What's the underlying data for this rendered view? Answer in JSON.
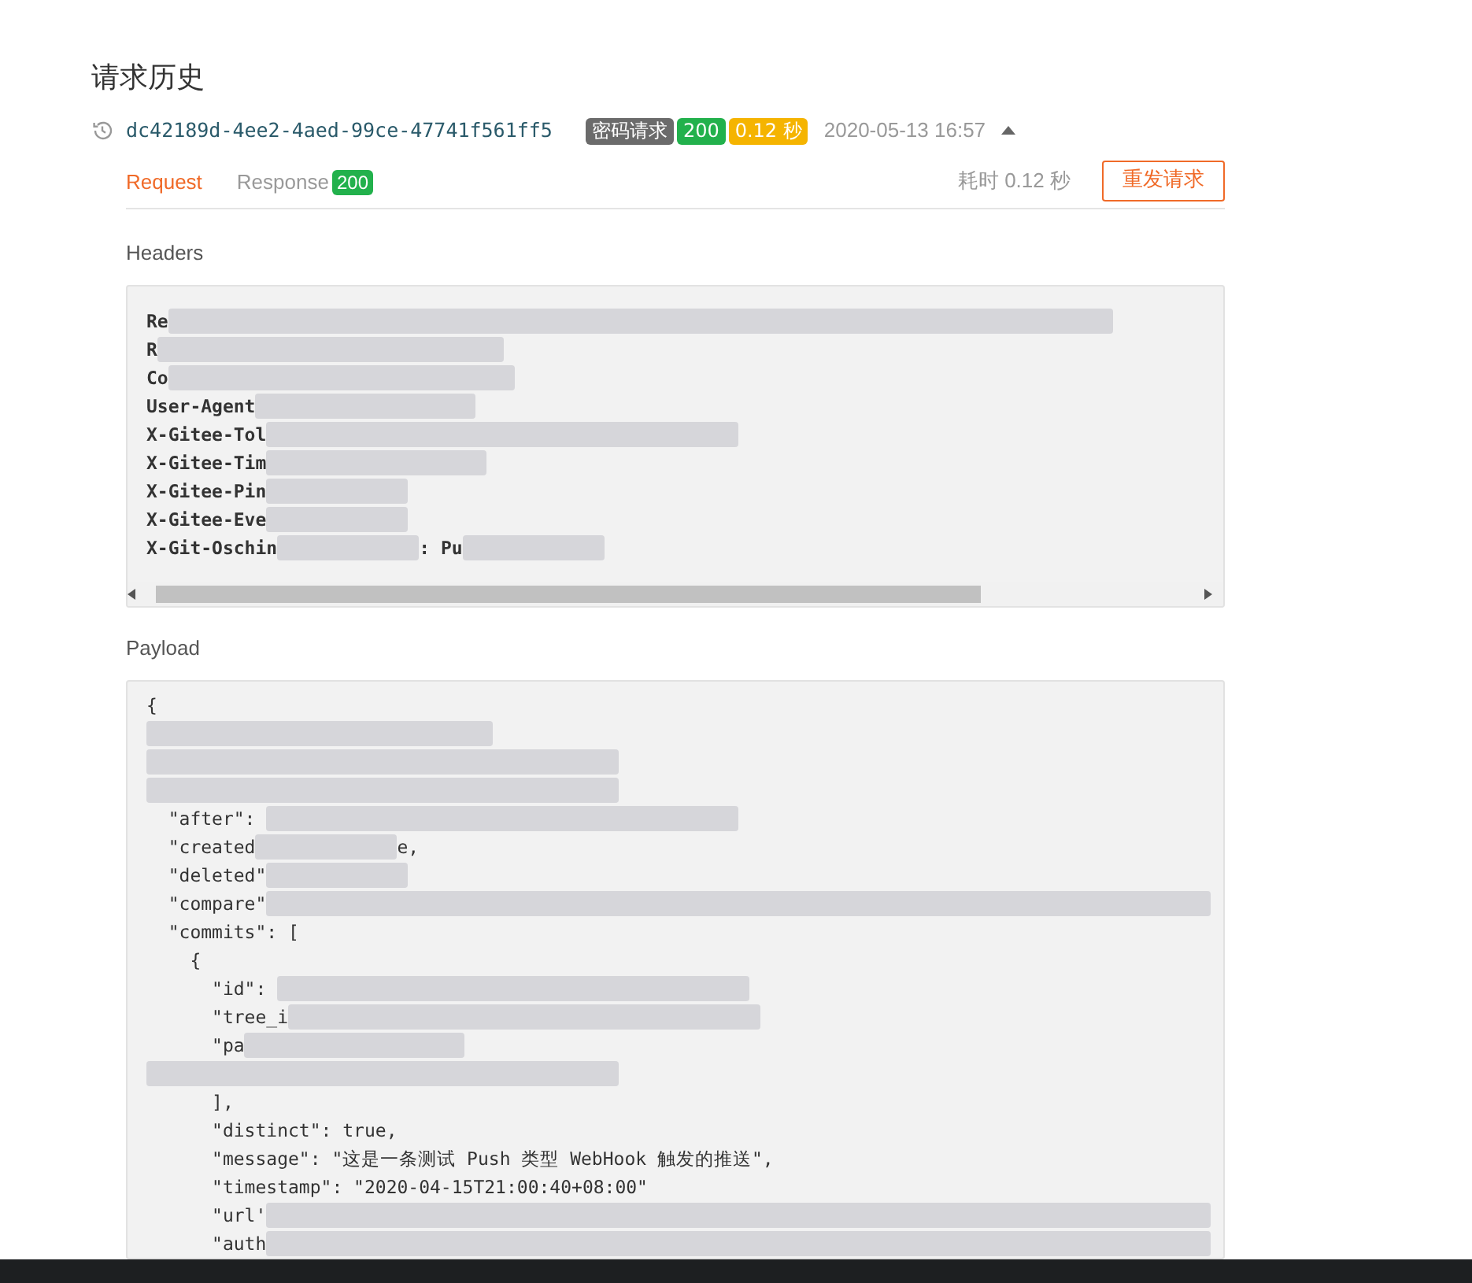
{
  "page_title": "请求历史",
  "request": {
    "id": "dc42189d-4ee2-4aed-99ce-47741f561ff5",
    "badges": [
      {
        "text": "密码请求",
        "color": "#6b6b6b"
      },
      {
        "text": "200",
        "color": "#22b14c"
      },
      {
        "text": "0.12 秒",
        "color": "#f5b400"
      }
    ],
    "time": "2020-05-13 16:57",
    "expanded": true
  },
  "tabs": [
    {
      "label": "Request",
      "selected": true
    },
    {
      "label": "Response",
      "badge": "200",
      "selected": false
    }
  ],
  "duration": "耗时 0.12 秒",
  "resend_button": "重发请求",
  "headers": {
    "label": "Headers",
    "lines": [
      [
        {
          "kind": "text",
          "text": "Re"
        },
        {
          "kind": "redacted"
        }
      ],
      [
        {
          "kind": "text",
          "text": "R"
        },
        {
          "kind": "redacted"
        }
      ],
      [
        {
          "kind": "text",
          "text": "Co"
        },
        {
          "kind": "redacted"
        }
      ],
      [
        {
          "kind": "text",
          "text": "User-Agent"
        },
        {
          "kind": "redacted"
        }
      ],
      [
        {
          "kind": "text",
          "text": "X-Gitee-Tol"
        },
        {
          "kind": "redacted"
        }
      ],
      [
        {
          "kind": "text",
          "text": "X-Gitee-Tim"
        },
        {
          "kind": "redacted"
        }
      ],
      [
        {
          "kind": "text",
          "text": "X-Gitee-Pin"
        },
        {
          "kind": "redacted"
        }
      ],
      [
        {
          "kind": "text",
          "text": "X-Gitee-Eve"
        },
        {
          "kind": "redacted"
        }
      ],
      [
        {
          "kind": "text",
          "text": "X-Git-Oschin"
        },
        {
          "kind": "redacted"
        },
        {
          "kind": "text",
          "text": ": Pu"
        },
        {
          "kind": "redacted"
        }
      ]
    ]
  },
  "payload": {
    "label": "Payload",
    "lines": [
      [
        {
          "kind": "text",
          "text": "{"
        }
      ],
      [
        {
          "kind": "redacted"
        }
      ],
      [
        {
          "kind": "redacted"
        }
      ],
      [
        {
          "kind": "redacted"
        }
      ],
      [
        {
          "kind": "text",
          "text": "  \"after\": "
        },
        {
          "kind": "redacted"
        }
      ],
      [
        {
          "kind": "text",
          "text": "  \"created"
        },
        {
          "kind": "redacted"
        },
        {
          "kind": "text",
          "text": "e,"
        }
      ],
      [
        {
          "kind": "text",
          "text": "  \"deleted\""
        },
        {
          "kind": "redacted"
        }
      ],
      [
        {
          "kind": "text",
          "text": "  \"compare\""
        },
        {
          "kind": "redacted"
        }
      ],
      [
        {
          "kind": "text",
          "text": "  \"commits\": ["
        }
      ],
      [
        {
          "kind": "text",
          "text": "    {"
        }
      ],
      [
        {
          "kind": "text",
          "text": "      \"id\": "
        },
        {
          "kind": "redacted"
        }
      ],
      [
        {
          "kind": "text",
          "text": "      \"tree_i"
        },
        {
          "kind": "redacted"
        }
      ],
      [
        {
          "kind": "text",
          "text": "      \"pa"
        },
        {
          "kind": "redacted"
        }
      ],
      [
        {
          "kind": "redacted"
        }
      ],
      [
        {
          "kind": "text",
          "text": "      ],"
        }
      ],
      [
        {
          "kind": "text",
          "text": "      \"distinct\": true,"
        }
      ],
      [
        {
          "kind": "text",
          "text": "      \"message\": \"这是一条测试 Push 类型 WebHook 触发的推送\","
        }
      ],
      [
        {
          "kind": "text",
          "text": "      \"timestamp\": \"2020-04-15T21:00:40+08:00\""
        }
      ],
      [
        {
          "kind": "text",
          "text": "      \"url'"
        },
        {
          "kind": "redacted"
        }
      ],
      [
        {
          "kind": "text",
          "text": "      \"auth"
        },
        {
          "kind": "redacted"
        }
      ]
    ]
  }
}
